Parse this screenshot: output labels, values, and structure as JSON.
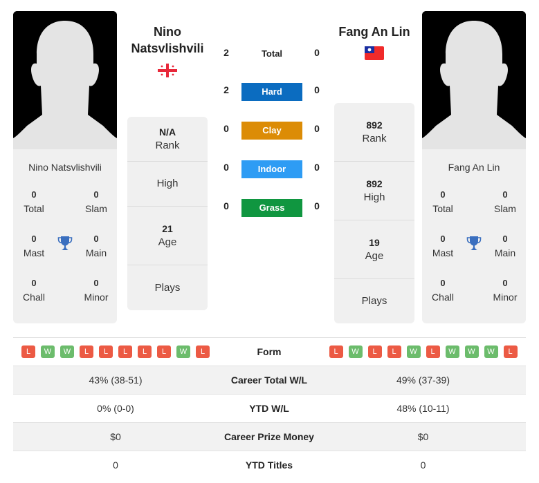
{
  "colors": {
    "hard": "#0b6cc0",
    "clay": "#dc8c06",
    "indoor": "#2e9cf4",
    "grass": "#109640",
    "win": "#6cbc6c",
    "loss": "#ec5a44",
    "trophy": "#3a6fbf"
  },
  "player1": {
    "name_line1": "Nino",
    "name_line2": "Natsvlishvili",
    "card_name": "Nino Natsvlishvili",
    "flag": "georgia-flag",
    "titles": {
      "total": {
        "value": "0",
        "label": "Total"
      },
      "slam": {
        "value": "0",
        "label": "Slam"
      },
      "mast": {
        "value": "0",
        "label": "Mast"
      },
      "main": {
        "value": "0",
        "label": "Main"
      },
      "chall": {
        "value": "0",
        "label": "Chall"
      },
      "minor": {
        "value": "0",
        "label": "Minor"
      }
    },
    "info": {
      "rank": {
        "value": "N/A",
        "label": "Rank"
      },
      "high": {
        "value": "",
        "label": "High"
      },
      "age": {
        "value": "21",
        "label": "Age"
      },
      "plays": {
        "value": "",
        "label": "Plays"
      }
    },
    "form": [
      "L",
      "W",
      "W",
      "L",
      "L",
      "L",
      "L",
      "L",
      "W",
      "L"
    ]
  },
  "player2": {
    "name": "Fang An Lin",
    "card_name": "Fang An Lin",
    "flag": "taiwan-flag",
    "titles": {
      "total": {
        "value": "0",
        "label": "Total"
      },
      "slam": {
        "value": "0",
        "label": "Slam"
      },
      "mast": {
        "value": "0",
        "label": "Mast"
      },
      "main": {
        "value": "0",
        "label": "Main"
      },
      "chall": {
        "value": "0",
        "label": "Chall"
      },
      "minor": {
        "value": "0",
        "label": "Minor"
      }
    },
    "info": {
      "rank": {
        "value": "892",
        "label": "Rank"
      },
      "high": {
        "value": "892",
        "label": "High"
      },
      "age": {
        "value": "19",
        "label": "Age"
      },
      "plays": {
        "value": "",
        "label": "Plays"
      }
    },
    "form": [
      "L",
      "W",
      "L",
      "L",
      "W",
      "L",
      "W",
      "W",
      "W",
      "L"
    ]
  },
  "h2h": [
    {
      "label": "Total",
      "p1": "2",
      "p2": "0"
    },
    {
      "label": "Hard",
      "p1": "2",
      "p2": "0"
    },
    {
      "label": "Clay",
      "p1": "0",
      "p2": "0"
    },
    {
      "label": "Indoor",
      "p1": "0",
      "p2": "0"
    },
    {
      "label": "Grass",
      "p1": "0",
      "p2": "0"
    }
  ],
  "stats": {
    "form_label": "Form",
    "rows": [
      {
        "label": "Career Total W/L",
        "p1": "43% (38-51)",
        "p2": "49% (37-39)"
      },
      {
        "label": "YTD W/L",
        "p1": "0% (0-0)",
        "p2": "48% (10-11)"
      },
      {
        "label": "Career Prize Money",
        "p1": "$0",
        "p2": "$0"
      },
      {
        "label": "YTD Titles",
        "p1": "0",
        "p2": "0"
      }
    ]
  }
}
